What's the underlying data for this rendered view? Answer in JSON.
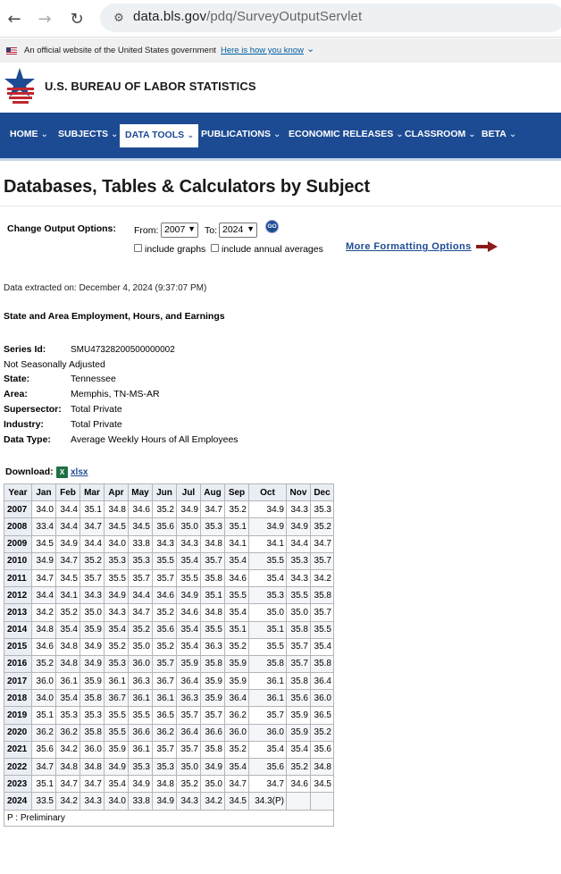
{
  "browser": {
    "url_host": "data.bls.gov",
    "url_path": "/pdq/SurveyOutputServlet"
  },
  "gov_banner": {
    "text": "An official website of the United States government",
    "link": "Here is how you know"
  },
  "header": {
    "title": "U.S. BUREAU OF LABOR STATISTICS"
  },
  "nav": {
    "items": [
      {
        "label": "HOME"
      },
      {
        "label": "SUBJECTS"
      },
      {
        "label": "DATA TOOLS"
      },
      {
        "label": "PUBLICATIONS"
      },
      {
        "label": "ECONOMIC RELEASES"
      },
      {
        "label": "CLASSROOM"
      },
      {
        "label": "BETA"
      }
    ],
    "active": "DATA TOOLS"
  },
  "page": {
    "title": "Databases, Tables & Calculators by Subject"
  },
  "options": {
    "label": "Change Output Options:",
    "from_label": "From:",
    "from_value": "2007",
    "to_label": "To:",
    "to_value": "2024",
    "go_label": "GO",
    "include_graphs": "include graphs",
    "include_annual": "include annual averages",
    "more_formatting": "More Formatting Options"
  },
  "extract_date": "Data extracted on: December 4, 2024 (9:37:07 PM)",
  "series_title": "State and Area Employment, Hours, and Earnings",
  "meta": {
    "series_id_key": "Series Id:",
    "series_id": "SMU47328200500000002",
    "adjustment": "Not Seasonally Adjusted",
    "state_key": "State:",
    "state": "Tennessee",
    "area_key": "Area:",
    "area": "Memphis, TN-MS-AR",
    "supersector_key": "Supersector:",
    "supersector": "Total Private",
    "industry_key": "Industry:",
    "industry": "Total Private",
    "datatype_key": "Data Type:",
    "datatype": "Average Weekly Hours of All Employees"
  },
  "download": {
    "label": "Download:",
    "icon_text": "X",
    "link": "xlsx"
  },
  "table": {
    "headers": [
      "Year",
      "Jan",
      "Feb",
      "Mar",
      "Apr",
      "May",
      "Jun",
      "Jul",
      "Aug",
      "Sep",
      "Oct",
      "Nov",
      "Dec"
    ],
    "rows": [
      [
        "2007",
        "34.0",
        "34.4",
        "35.1",
        "34.8",
        "34.6",
        "35.2",
        "34.9",
        "34.7",
        "35.2",
        "34.9",
        "34.3",
        "35.3"
      ],
      [
        "2008",
        "33.4",
        "34.4",
        "34.7",
        "34.5",
        "34.5",
        "35.6",
        "35.0",
        "35.3",
        "35.1",
        "34.9",
        "34.9",
        "35.2"
      ],
      [
        "2009",
        "34.5",
        "34.9",
        "34.4",
        "34.0",
        "33.8",
        "34.3",
        "34.3",
        "34.8",
        "34.1",
        "34.1",
        "34.4",
        "34.7"
      ],
      [
        "2010",
        "34.9",
        "34.7",
        "35.2",
        "35.3",
        "35.3",
        "35.5",
        "35.4",
        "35.7",
        "35.4",
        "35.5",
        "35.3",
        "35.7"
      ],
      [
        "2011",
        "34.7",
        "34.5",
        "35.7",
        "35.5",
        "35.7",
        "35.7",
        "35.5",
        "35.8",
        "34.6",
        "35.4",
        "34.3",
        "34.2"
      ],
      [
        "2012",
        "34.4",
        "34.1",
        "34.3",
        "34.9",
        "34.4",
        "34.6",
        "34.9",
        "35.1",
        "35.5",
        "35.3",
        "35.5",
        "35.8"
      ],
      [
        "2013",
        "34.2",
        "35.2",
        "35.0",
        "34.3",
        "34.7",
        "35.2",
        "34.6",
        "34.8",
        "35.4",
        "35.0",
        "35.0",
        "35.7"
      ],
      [
        "2014",
        "34.8",
        "35.4",
        "35.9",
        "35.4",
        "35.2",
        "35.6",
        "35.4",
        "35.5",
        "35.1",
        "35.1",
        "35.8",
        "35.5"
      ],
      [
        "2015",
        "34.6",
        "34.8",
        "34.9",
        "35.2",
        "35.0",
        "35.2",
        "35.4",
        "36.3",
        "35.2",
        "35.5",
        "35.7",
        "35.4"
      ],
      [
        "2016",
        "35.2",
        "34.8",
        "34.9",
        "35.3",
        "36.0",
        "35.7",
        "35.9",
        "35.8",
        "35.9",
        "35.8",
        "35.7",
        "35.8"
      ],
      [
        "2017",
        "36.0",
        "36.1",
        "35.9",
        "36.1",
        "36.3",
        "36.7",
        "36.4",
        "35.9",
        "35.9",
        "36.1",
        "35.8",
        "36.4"
      ],
      [
        "2018",
        "34.0",
        "35.4",
        "35.8",
        "36.7",
        "36.1",
        "36.1",
        "36.3",
        "35.9",
        "36.4",
        "36.1",
        "35.6",
        "36.0"
      ],
      [
        "2019",
        "35.1",
        "35.3",
        "35.3",
        "35.5",
        "35.5",
        "36.5",
        "35.7",
        "35.7",
        "36.2",
        "35.7",
        "35.9",
        "36.5"
      ],
      [
        "2020",
        "36.2",
        "36.2",
        "35.8",
        "35.5",
        "36.6",
        "36.2",
        "36.4",
        "36.6",
        "36.0",
        "36.0",
        "35.9",
        "35.2"
      ],
      [
        "2021",
        "35.6",
        "34.2",
        "36.0",
        "35.9",
        "36.1",
        "35.7",
        "35.7",
        "35.8",
        "35.2",
        "35.4",
        "35.4",
        "35.6"
      ],
      [
        "2022",
        "34.7",
        "34.8",
        "34.8",
        "34.9",
        "35.3",
        "35.3",
        "35.0",
        "34.9",
        "35.4",
        "35.6",
        "35.2",
        "34.8"
      ],
      [
        "2023",
        "35.1",
        "34.7",
        "34.7",
        "35.4",
        "34.9",
        "34.8",
        "35.2",
        "35.0",
        "34.7",
        "34.7",
        "34.6",
        "34.5"
      ],
      [
        "2024",
        "33.5",
        "34.2",
        "34.3",
        "34.0",
        "33.8",
        "34.9",
        "34.3",
        "34.2",
        "34.5",
        "34.3(P)",
        "",
        ""
      ]
    ],
    "footnote": "P : Preliminary"
  },
  "colors": {
    "nav_bg": "#1d4b93",
    "header_cell_bg": "#e9eef5",
    "arrow": "#8b1a1a",
    "excel_green": "#1e7145"
  }
}
